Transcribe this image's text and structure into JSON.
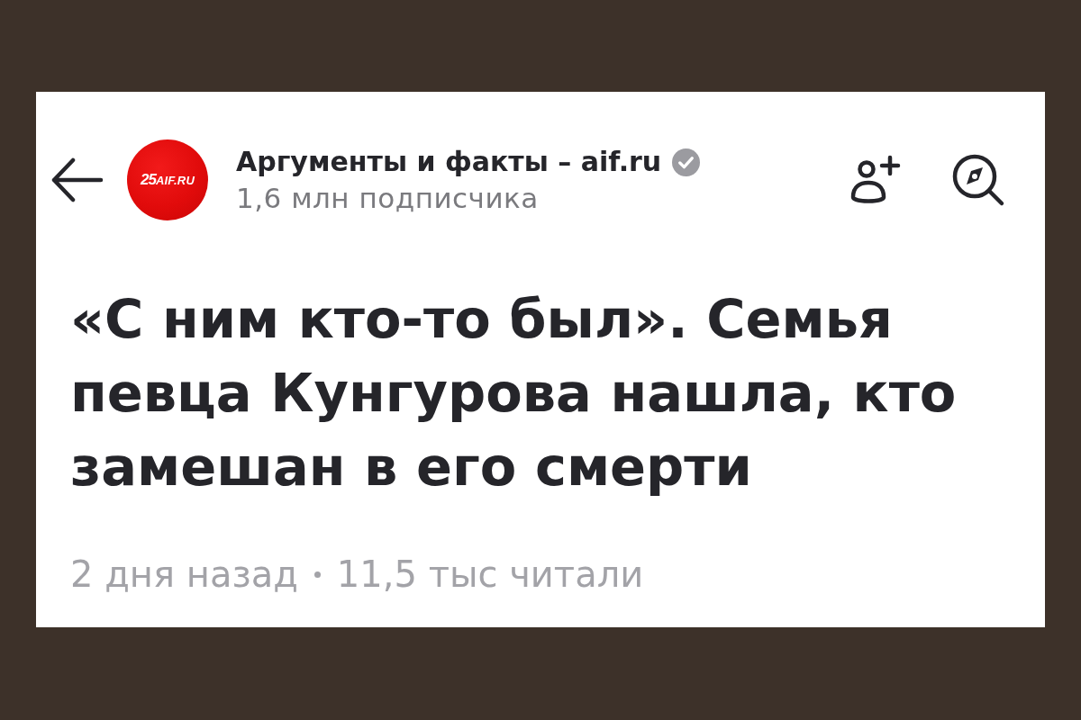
{
  "header": {
    "channel_name": "Аргументы и факты – aif.ru",
    "verified": true,
    "subscribers": "1,6 млн подписчика",
    "logo": {
      "mark": "25",
      "text": "AIF.RU"
    }
  },
  "article": {
    "headline": "«С ним кто-то был». Семья певца Кунгурова нашла, кто замешан в его смерти",
    "published": "2 дня назад",
    "views": "11,5 тыс читали"
  }
}
